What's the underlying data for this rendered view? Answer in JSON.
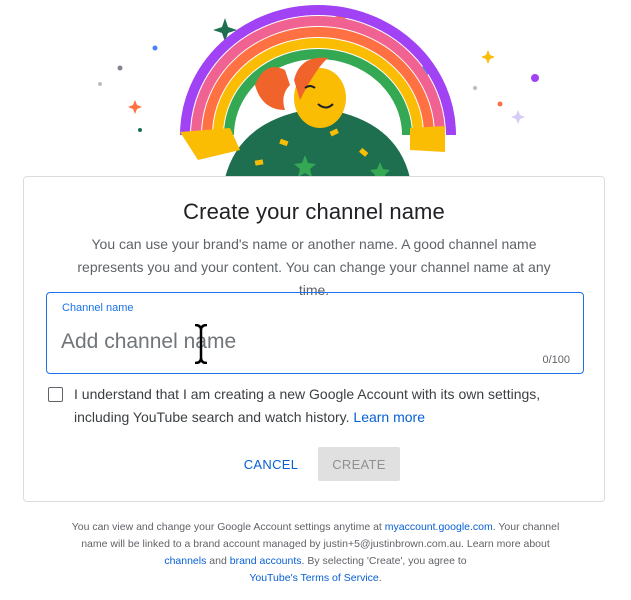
{
  "dialog": {
    "title": "Create your channel name",
    "subtitle": "You can use your brand's name or another name. A good channel name represents you and your content. You can change your channel name at any time."
  },
  "channel_field": {
    "label": "Channel name",
    "value": "",
    "placeholder": "Add channel name",
    "counter": "0/100"
  },
  "agreement": {
    "checked": false,
    "text": "I understand that I am creating a new Google Account with its own settings, including YouTube search and watch history.",
    "link": "Learn more"
  },
  "buttons": {
    "cancel": "CANCEL",
    "create": "CREATE"
  },
  "footer": {
    "text1": "You can view and change your Google Account settings anytime at",
    "link_account": "myaccount.google.com",
    "text2": ". Your channel name will be linked to a brand account managed by justin+5@justinbrown.com.au. Learn more about",
    "link_channels": "channels",
    "text3": "and",
    "link_brand": "brand accounts",
    "text4": ". By selecting 'Create', you agree to",
    "link_terms": "YouTube's Terms of Service",
    "text5": "."
  },
  "icons": {
    "cursor": "text-cursor-icon",
    "illustration": "rainbow-person-illustration"
  },
  "colors": {
    "accent": "#1a73e8",
    "link": "#065fd4",
    "disabled_button": "#e0e0e0"
  }
}
